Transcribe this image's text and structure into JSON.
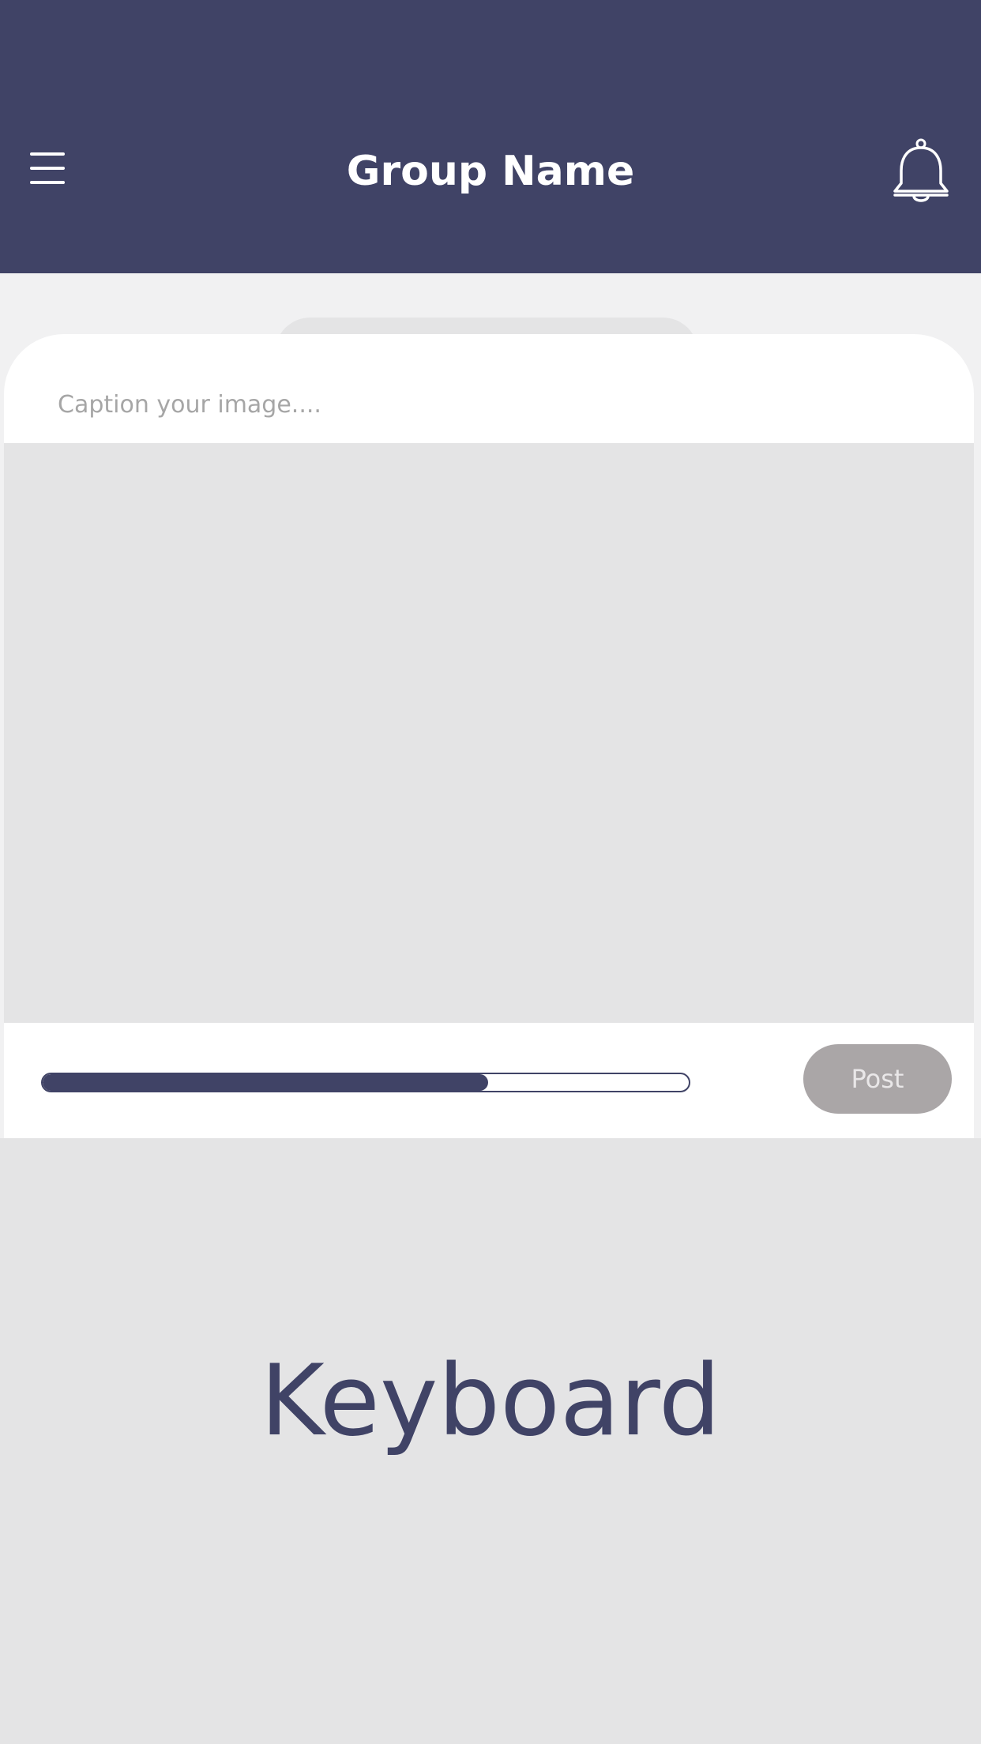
{
  "header": {
    "title": "Group Name",
    "menu_icon": "hamburger-menu-icon",
    "notifications_icon": "bell-icon"
  },
  "composer": {
    "caption_placeholder": "Caption your image....",
    "caption_value": "",
    "upload_progress": 0.69,
    "post_label": "Post"
  },
  "keyboard": {
    "label": "Keyboard"
  },
  "colors": {
    "brand": "#404366",
    "background": "#f1f1f2",
    "placeholder_gray": "#e4e4e5",
    "post_button": "#aaa6a7"
  }
}
